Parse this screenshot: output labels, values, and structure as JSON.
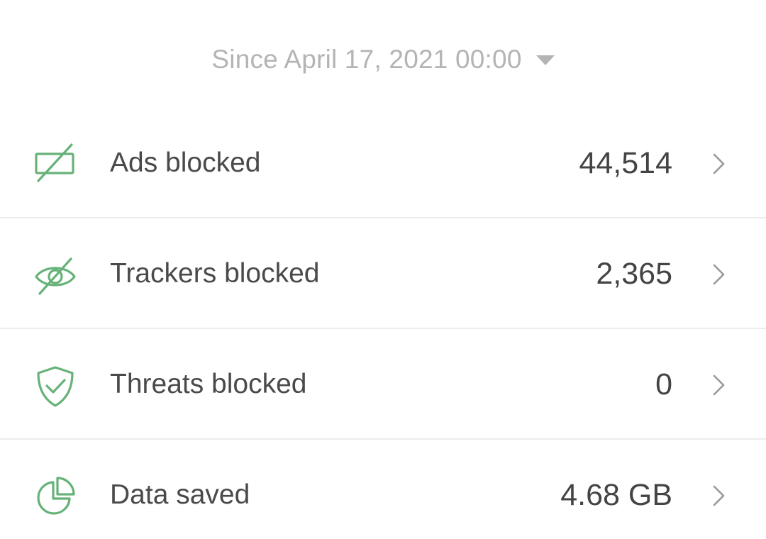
{
  "period": {
    "label": "Since April 17, 2021 00:00",
    "icon": "caret-down-icon"
  },
  "accent_color": "#67b279",
  "stats": [
    {
      "label": "Ads blocked",
      "value": "44,514",
      "icon": "ad-blocked-icon"
    },
    {
      "label": "Trackers blocked",
      "value": "2,365",
      "icon": "eye-slash-icon"
    },
    {
      "label": "Threats blocked",
      "value": "0",
      "icon": "shield-check-icon"
    },
    {
      "label": "Data saved",
      "value": "4.68 GB",
      "icon": "pie-chart-icon"
    }
  ]
}
